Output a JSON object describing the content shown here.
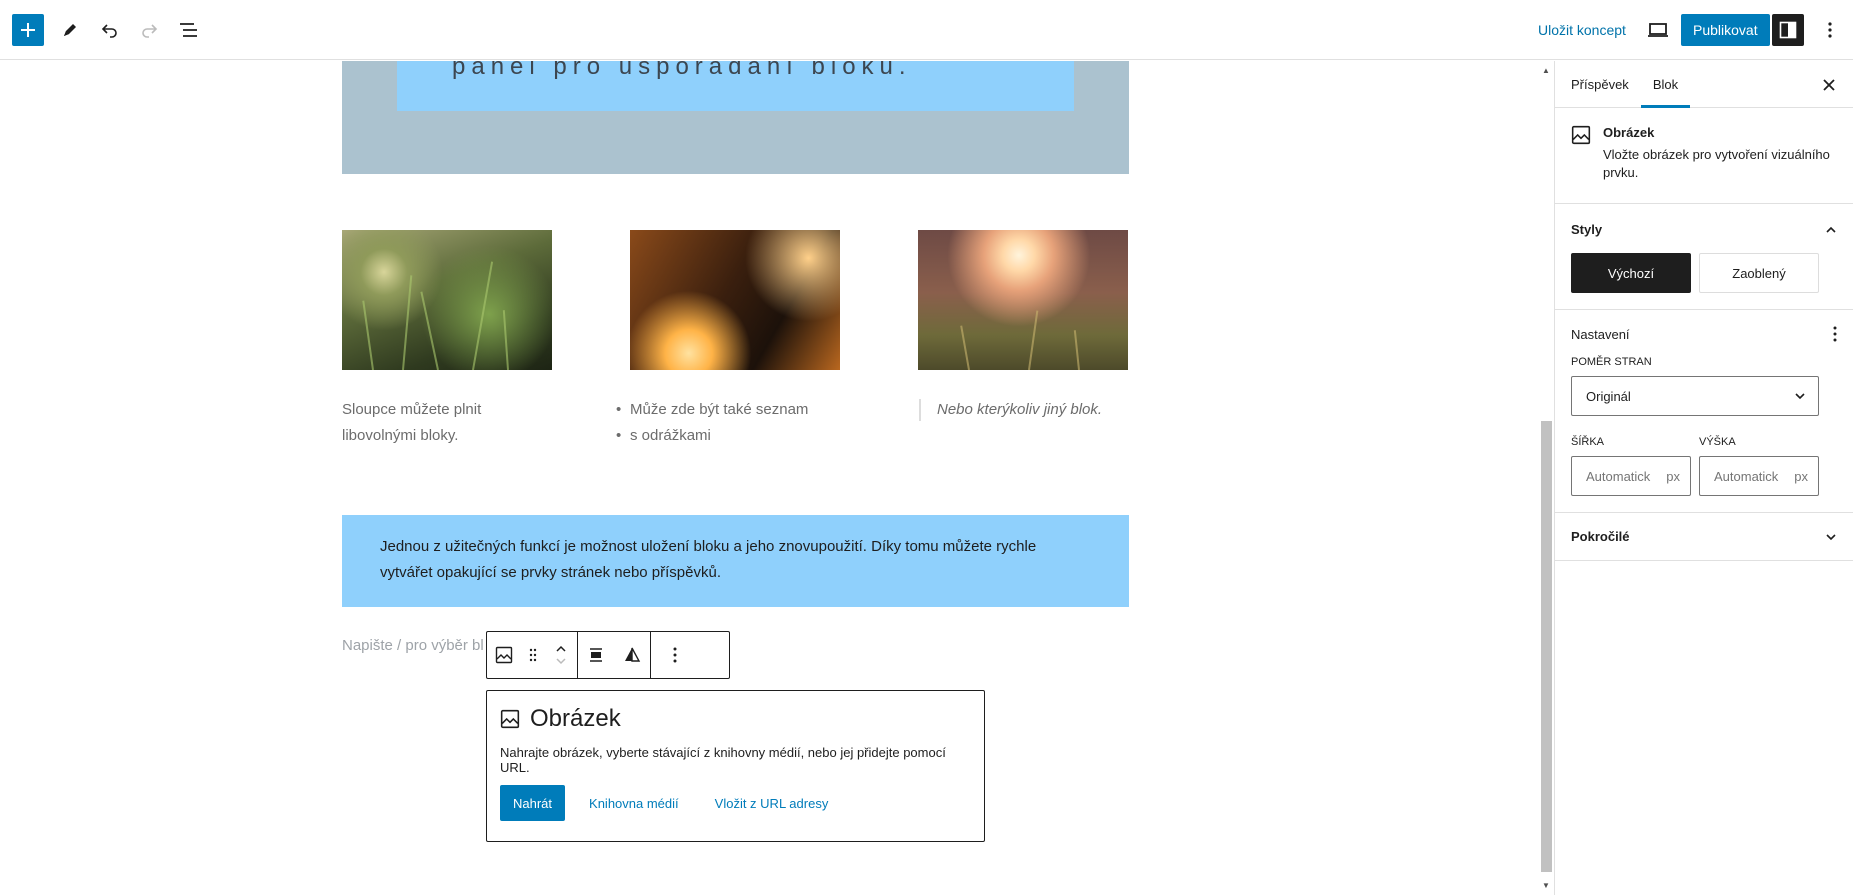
{
  "toolbar": {
    "save_draft_label": "Uložit koncept",
    "publish_label": "Publikovat"
  },
  "canvas": {
    "cover_text": "panel pro uspořádání bloku.",
    "columns": [
      {
        "text": "Sloupce můžete plnit libovolnými bloky."
      },
      {
        "list": [
          "Může zde být také seznam",
          "s odrážkami"
        ]
      },
      {
        "quote": "Nebo kterýkoliv jiný blok."
      }
    ],
    "notice_text": "Jednou z užitečných funkcí je možnost uložení bloku a jeho znovupoužití. Díky tomu můžete rychle vytvářet opakující se prvky stránek nebo příspěvků.",
    "paragraph_placeholder": "Napište / pro výběr bl",
    "image_block": {
      "title": "Obrázek",
      "description": "Nahrajte obrázek, vyberte stávající z knihovny médií, nebo jej přidejte pomocí URL.",
      "upload_label": "Nahrát",
      "media_library_label": "Knihovna médií",
      "insert_url_label": "Vložit z URL adresy"
    }
  },
  "sidebar": {
    "tabs": [
      {
        "label": "Příspěvek",
        "active": false
      },
      {
        "label": "Blok",
        "active": true
      }
    ],
    "block_card": {
      "title": "Obrázek",
      "description": "Vložte obrázek pro vytvoření vizuálního prvku."
    },
    "styles": {
      "heading": "Styly",
      "options": [
        {
          "label": "Výchozí",
          "active": true
        },
        {
          "label": "Zaoblený",
          "active": false
        }
      ]
    },
    "settings": {
      "heading": "Nastavení",
      "aspect_ratio_label": "POMĚR STRAN",
      "aspect_ratio_value": "Originál",
      "width_label": "ŠÍŘKA",
      "height_label": "VÝŠKA",
      "width_placeholder": "Automatick",
      "height_placeholder": "Automatick",
      "unit": "px"
    },
    "advanced": {
      "heading": "Pokročilé"
    }
  },
  "colors": {
    "accent": "#007cba",
    "cover_bg": "#abc2cf",
    "highlight_bg": "#8fd0fc",
    "dark": "#1e1e1e"
  },
  "icons": [
    "plus-icon",
    "pencil-icon",
    "undo-icon",
    "redo-icon",
    "list-view-icon",
    "desktop-preview-icon",
    "sidebar-toggle-icon",
    "more-vertical-icon",
    "close-icon",
    "image-icon",
    "drag-handle-icon",
    "chevron-up-icon",
    "chevron-down-icon",
    "align-icon",
    "flip-icon"
  ]
}
